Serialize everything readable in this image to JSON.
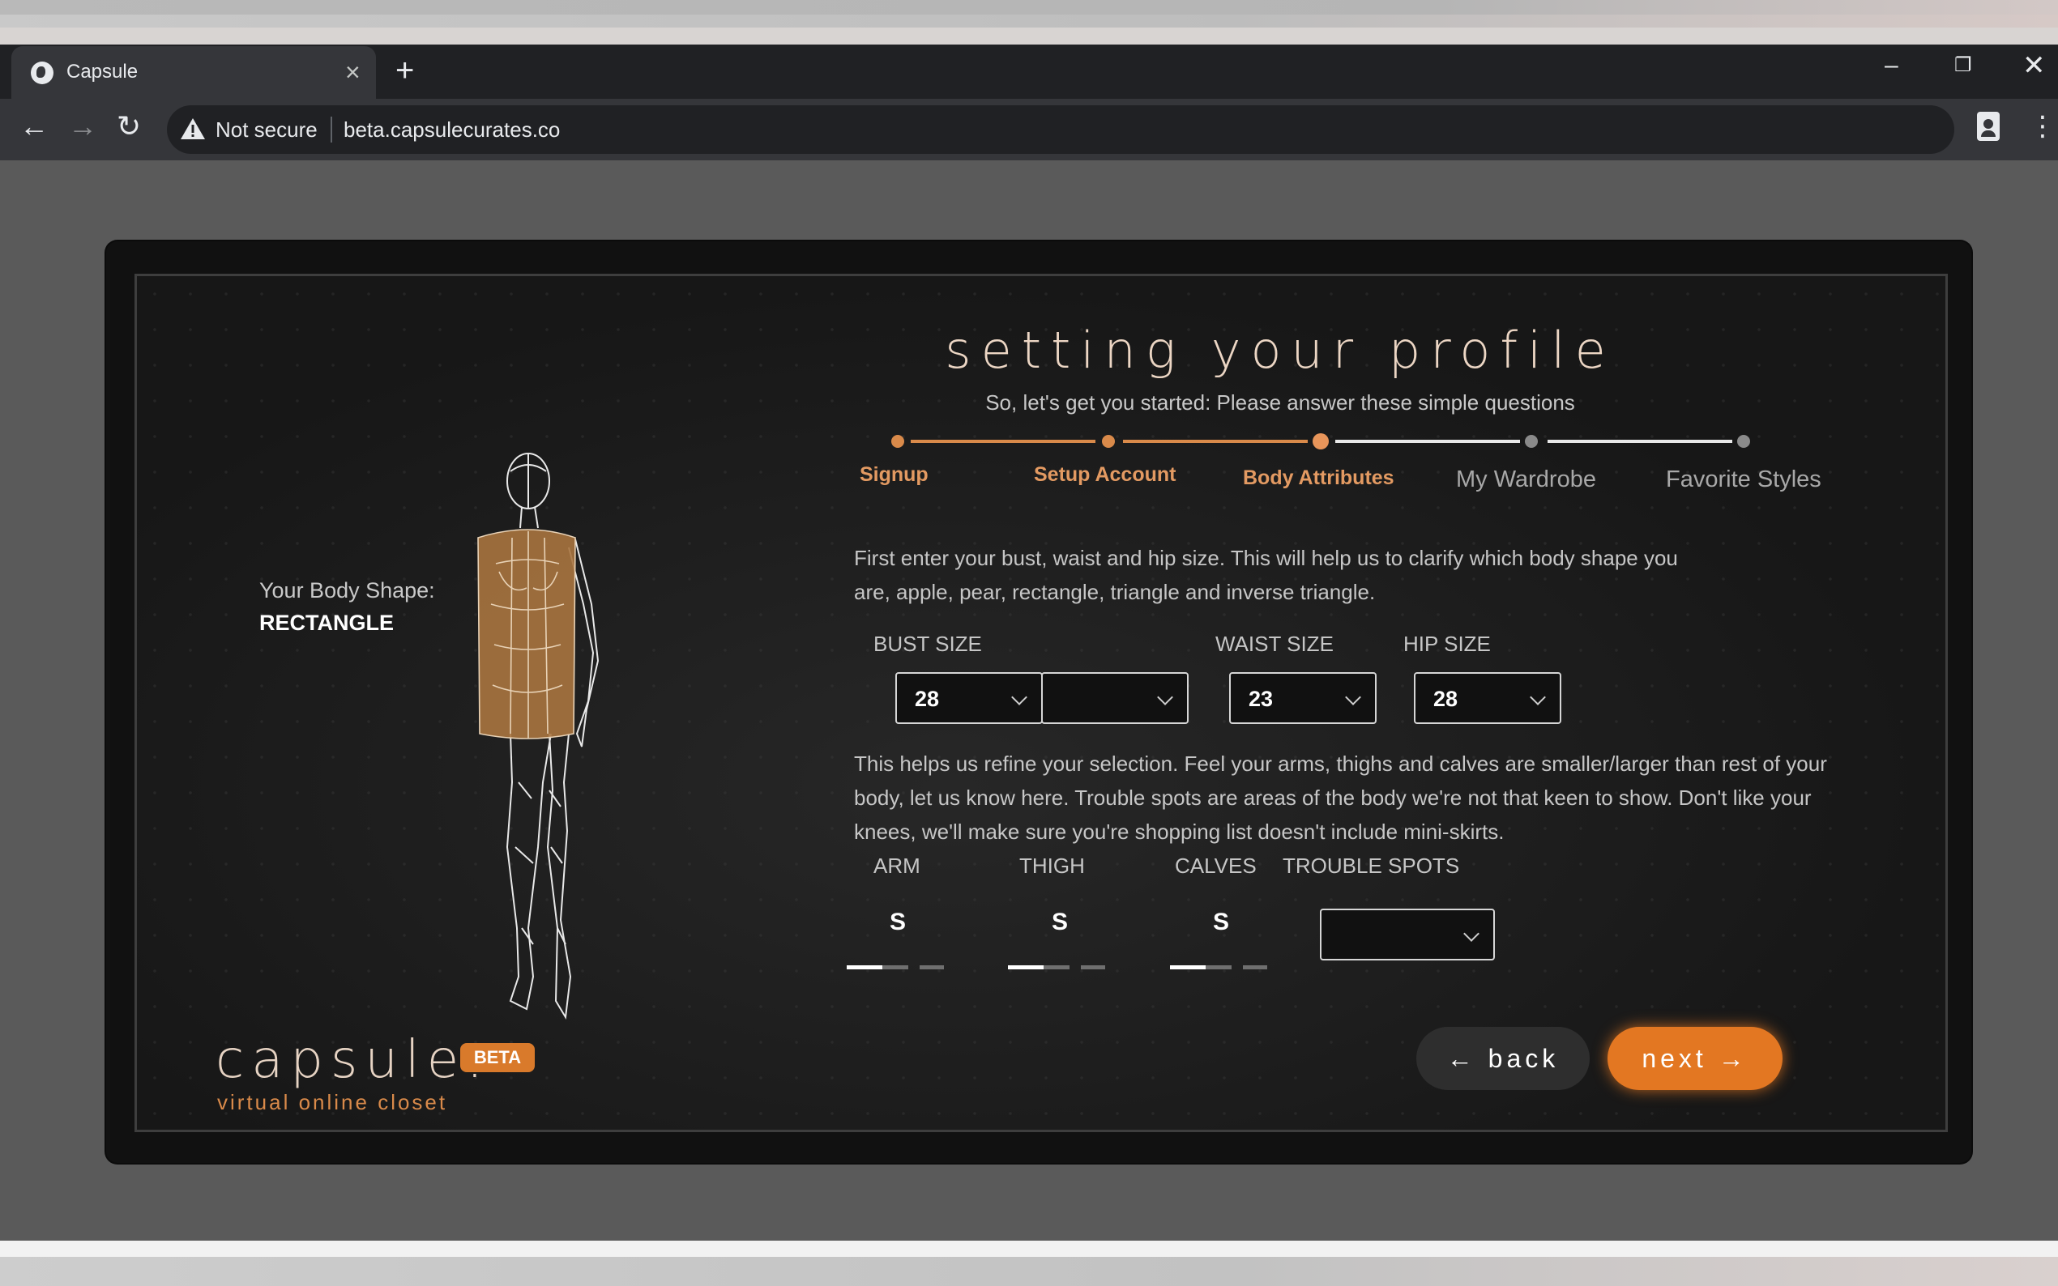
{
  "browser": {
    "tab_title": "Capsule",
    "tab_close": "×",
    "new_tab": "+",
    "security_label": "Not secure",
    "url": "beta.capsulecurates.co",
    "window_min": "–",
    "window_max": "❐",
    "window_close": "✕",
    "back_icon": "←",
    "forward_icon": "→",
    "reload_icon": "↻",
    "menu_icon": "⋮"
  },
  "header": {
    "title": "setting your profile",
    "subtitle": "So, let's get you started: Please answer these simple questions"
  },
  "stepper": {
    "steps": [
      {
        "label": "Signup",
        "state": "done"
      },
      {
        "label": "Setup Account",
        "state": "done"
      },
      {
        "label": "Body Attributes",
        "state": "current"
      },
      {
        "label": "My Wardrobe",
        "state": "todo"
      },
      {
        "label": "Favorite Styles",
        "state": "todo"
      }
    ]
  },
  "body_shape": {
    "label": "Your Body Shape:",
    "value": "RECTANGLE"
  },
  "intro_text": "First enter your bust, waist and hip size. This will help us to clarify which body shape you are, apple, pear, rectangle, triangle and inverse triangle.",
  "sizes": {
    "bust_label": "BUST SIZE",
    "bust_value": "28",
    "bust_cup_value": "",
    "waist_label": "WAIST SIZE",
    "waist_value": "23",
    "hip_label": "HIP SIZE",
    "hip_value": "28"
  },
  "refine_text": "This helps us refine your selection. Feel your arms, thighs and calves are smaller/larger than rest of your body, let us know here. Trouble spots are areas of the body we're not that keen to show. Don't like your knees, we'll make sure you're shopping list doesn't include mini-skirts.",
  "proportions": {
    "arm_label": "ARM",
    "arm_value": "S",
    "thigh_label": "THIGH",
    "thigh_value": "S",
    "calves_label": "CALVES",
    "calves_value": "S",
    "trouble_label": "TROUBLE SPOTS",
    "trouble_value": ""
  },
  "buttons": {
    "back": "← back",
    "next": "next →"
  },
  "brand": {
    "name": "capsule:",
    "badge": "BETA",
    "tagline": "virtual online closet"
  },
  "colors": {
    "accent": "#e37722",
    "step_done": "#d98a4a",
    "figure_fill": "#a8743f"
  }
}
